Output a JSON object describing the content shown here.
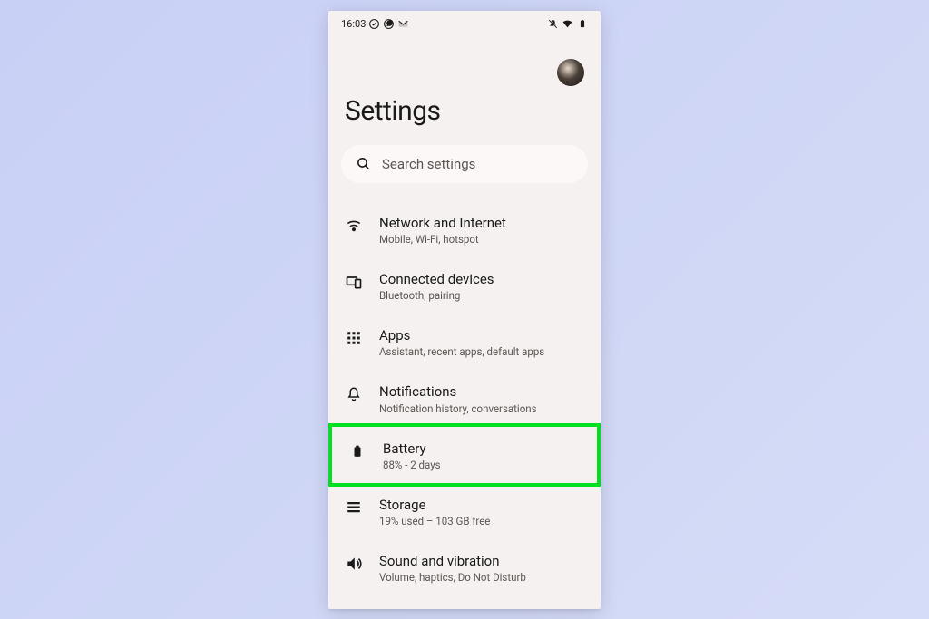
{
  "status": {
    "time": "16:03"
  },
  "header": {
    "title": "Settings"
  },
  "search": {
    "placeholder": "Search settings"
  },
  "items": [
    {
      "title": "Network and Internet",
      "sub": "Mobile, Wi-Fi, hotspot"
    },
    {
      "title": "Connected devices",
      "sub": "Bluetooth, pairing"
    },
    {
      "title": "Apps",
      "sub": "Assistant, recent apps, default apps"
    },
    {
      "title": "Notifications",
      "sub": "Notification history, conversations"
    },
    {
      "title": "Battery",
      "sub": "88% - 2 days"
    },
    {
      "title": "Storage",
      "sub": "19% used – 103 GB free"
    },
    {
      "title": "Sound and vibration",
      "sub": "Volume, haptics, Do Not Disturb"
    }
  ]
}
